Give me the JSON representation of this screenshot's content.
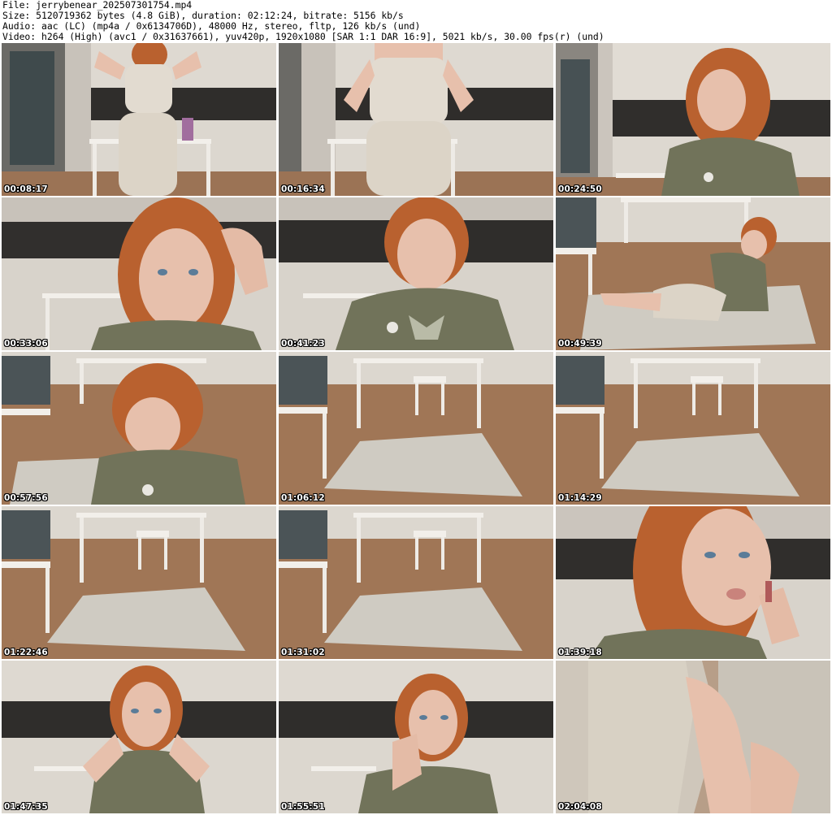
{
  "header": {
    "file_line": "File: jerrybenear_202507301754.mp4",
    "size_line": "Size: 5120719362 bytes (4.8 GiB), duration: 02:12:24, bitrate: 5156 kb/s",
    "audio_line": "Audio: aac (LC) (mp4a / 0x6134706D), 48000 Hz, stereo, fltp, 126 kb/s (und)",
    "video_line": "Video: h264 (High) (avc1 / 0x31637661), yuv420p, 1920x1080 [SAR 1:1 DAR 16:9], 5021 kb/s, 30.00 fps(r) (und)"
  },
  "thumbnails": [
    {
      "timestamp": "00:08:17"
    },
    {
      "timestamp": "00:16:34"
    },
    {
      "timestamp": "00:24:50"
    },
    {
      "timestamp": "00:33:06"
    },
    {
      "timestamp": "00:41:23"
    },
    {
      "timestamp": "00:49:39"
    },
    {
      "timestamp": "00:57:56"
    },
    {
      "timestamp": "01:06:12"
    },
    {
      "timestamp": "01:14:29"
    },
    {
      "timestamp": "01:22:46"
    },
    {
      "timestamp": "01:31:02"
    },
    {
      "timestamp": "01:39:18"
    },
    {
      "timestamp": "01:47:35"
    },
    {
      "timestamp": "01:55:51"
    },
    {
      "timestamp": "02:04:08"
    }
  ],
  "colors": {
    "page_background": "#ffffff",
    "header_text": "#000000",
    "timestamp_text": "#ffffff",
    "timestamp_outline": "#000000",
    "wall": "#c9c3bb",
    "cabinet": "#ddd8d0",
    "backsplash": "#2d2b2a",
    "floor": "#9a7052",
    "hair": "#b9612f",
    "skin": "#e7c0ac",
    "shirt": "#71735a",
    "shorts": "#d8d1c4"
  }
}
